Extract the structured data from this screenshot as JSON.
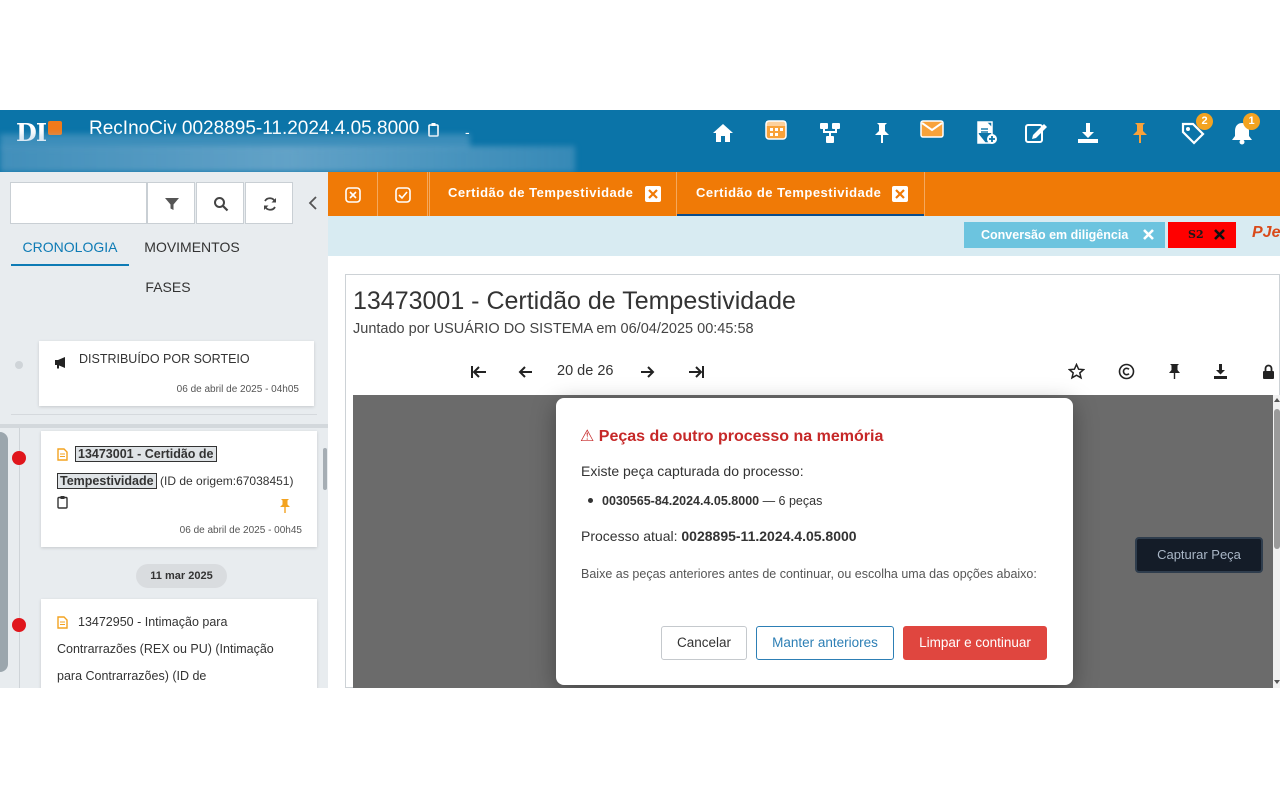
{
  "header": {
    "logo_text": "DI",
    "title": "RecInoCiv 0028895-11.2024.4.05.8000",
    "dash": "-",
    "badges": {
      "tags": "2",
      "notifications": "1"
    }
  },
  "left_panel": {
    "search_placeholder": "",
    "tabs": {
      "cronologia": "CRONOLOGIA",
      "movimentos": "MOVIMENTOS",
      "fases": "FASES"
    },
    "items": [
      {
        "text": "DISTRIBUÍDO POR SORTEIO",
        "date": "06 de abril de 2025 - 04h05"
      },
      {
        "text_link": "13473001 - Certidão de Tempestividade",
        "link_part1": "13473001 - Certidão de",
        "link_part2": "Tempestividade",
        "text_extra": "(ID de origem:67038451)",
        "date": "06 de abril de 2025 - 00h45"
      },
      {
        "line1": "13472950 - Intimação para",
        "line2": "Contrarrazões (REX ou PU) (Intimação",
        "line3": "para Contrarrazões) (ID de"
      }
    ],
    "date_pill": "11 mar 2025"
  },
  "tabs_bar": {
    "tabs": [
      {
        "label": "Certidão de Tempestividade"
      },
      {
        "label": "Certidão de Tempestividade"
      }
    ]
  },
  "chips": {
    "conversao": "Conversão em diligência",
    "s2": "S2",
    "pje": "PJe"
  },
  "document": {
    "title": "13473001 - Certidão de Tempestividade",
    "subtitle": "Juntado por USUÁRIO DO SISTEMA em 06/04/2025 00:45:58",
    "pages": "20 de 26",
    "capturar": "Capturar Peça"
  },
  "modal": {
    "title": "⚠ Peças de outro processo na memória",
    "line1": "Existe peça capturada do processo:",
    "item_process": "0030565-84.2024.4.05.8000",
    "item_count": "— 6 peças",
    "atual_label": "Processo atual:",
    "atual_value": "0028895-11.2024.4.05.8000",
    "note": "Baixe as peças anteriores antes de continuar, ou escolha uma das opções abaixo:",
    "buttons": {
      "cancel": "Cancelar",
      "manter": "Manter anteriores",
      "limpar": "Limpar e continuar"
    }
  },
  "colors": {
    "header": "#0b74a8",
    "accent": "#f07a06",
    "danger": "#e0463f",
    "link": "#0e7bb5"
  }
}
